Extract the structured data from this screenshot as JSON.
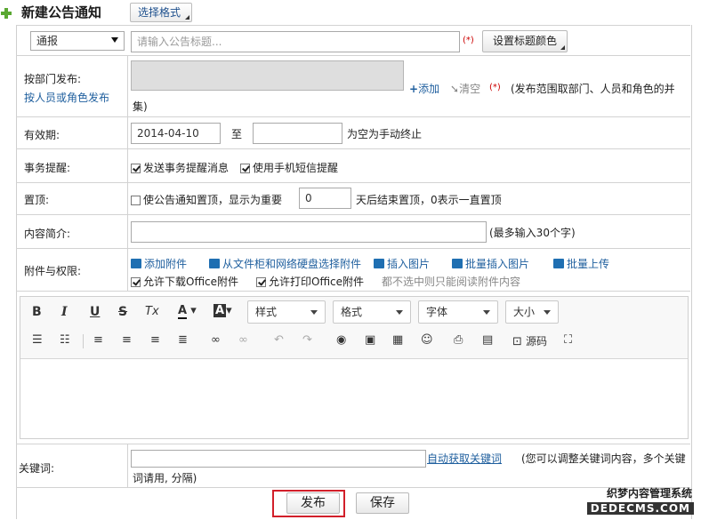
{
  "header": {
    "title": "新建公告通知",
    "format_button": "选择格式"
  },
  "type_select": {
    "value": "通报"
  },
  "title_field": {
    "placeholder": "请输入公告标题...",
    "required": "(*)",
    "color_button": "设置标题颜色"
  },
  "dept": {
    "label": "按部门发布:",
    "switch_link": "按人员或角色发布",
    "add": "添加",
    "clear": "清空",
    "required": "(*)",
    "note_line1": "(发布范围取部门、人员和角色的并",
    "note_line2": "集)"
  },
  "validity": {
    "label": "有效期:",
    "start": "2014-04-10",
    "to": "至",
    "note": "为空为手动终止"
  },
  "reminder": {
    "label": "事务提醒:",
    "opt1": "发送事务提醒消息",
    "opt2": "使用手机短信提醒"
  },
  "top": {
    "label": "置顶:",
    "text": "使公告通知置顶，显示为重要",
    "days": "0",
    "note": "天后结束置顶，0表示一直置顶"
  },
  "summary": {
    "label": "内容简介:",
    "note": "(最多输入30个字)"
  },
  "attach": {
    "label": "附件与权限:",
    "add": "添加附件",
    "from_cabinet": "从文件柜和网络硬盘选择附件",
    "insert_image": "插入图片",
    "batch_image": "批量插入图片",
    "batch_upload": "批量上传",
    "allow_download": "允许下载Office附件",
    "allow_print": "允许打印Office附件",
    "hint": "都不选中则只能阅读附件内容"
  },
  "editor": {
    "style": "样式",
    "format": "格式",
    "font": "字体",
    "size": "大小",
    "source": "源码",
    "bold": "B",
    "italic": "I",
    "underline": "U",
    "strike": "S",
    "clear": "Tx",
    "fontcolor": "A",
    "bgcolor": "A"
  },
  "keywords": {
    "label": "关键词:",
    "auto": "自动获取关键词",
    "note_line1": "(您可以调整关键词内容，多个关键",
    "note_line2": "词请用, 分隔)"
  },
  "actions": {
    "publish": "发布",
    "save": "保存"
  },
  "watermark": {
    "line1": "织梦内容管理系统",
    "line2": "DEDECMS.COM"
  }
}
